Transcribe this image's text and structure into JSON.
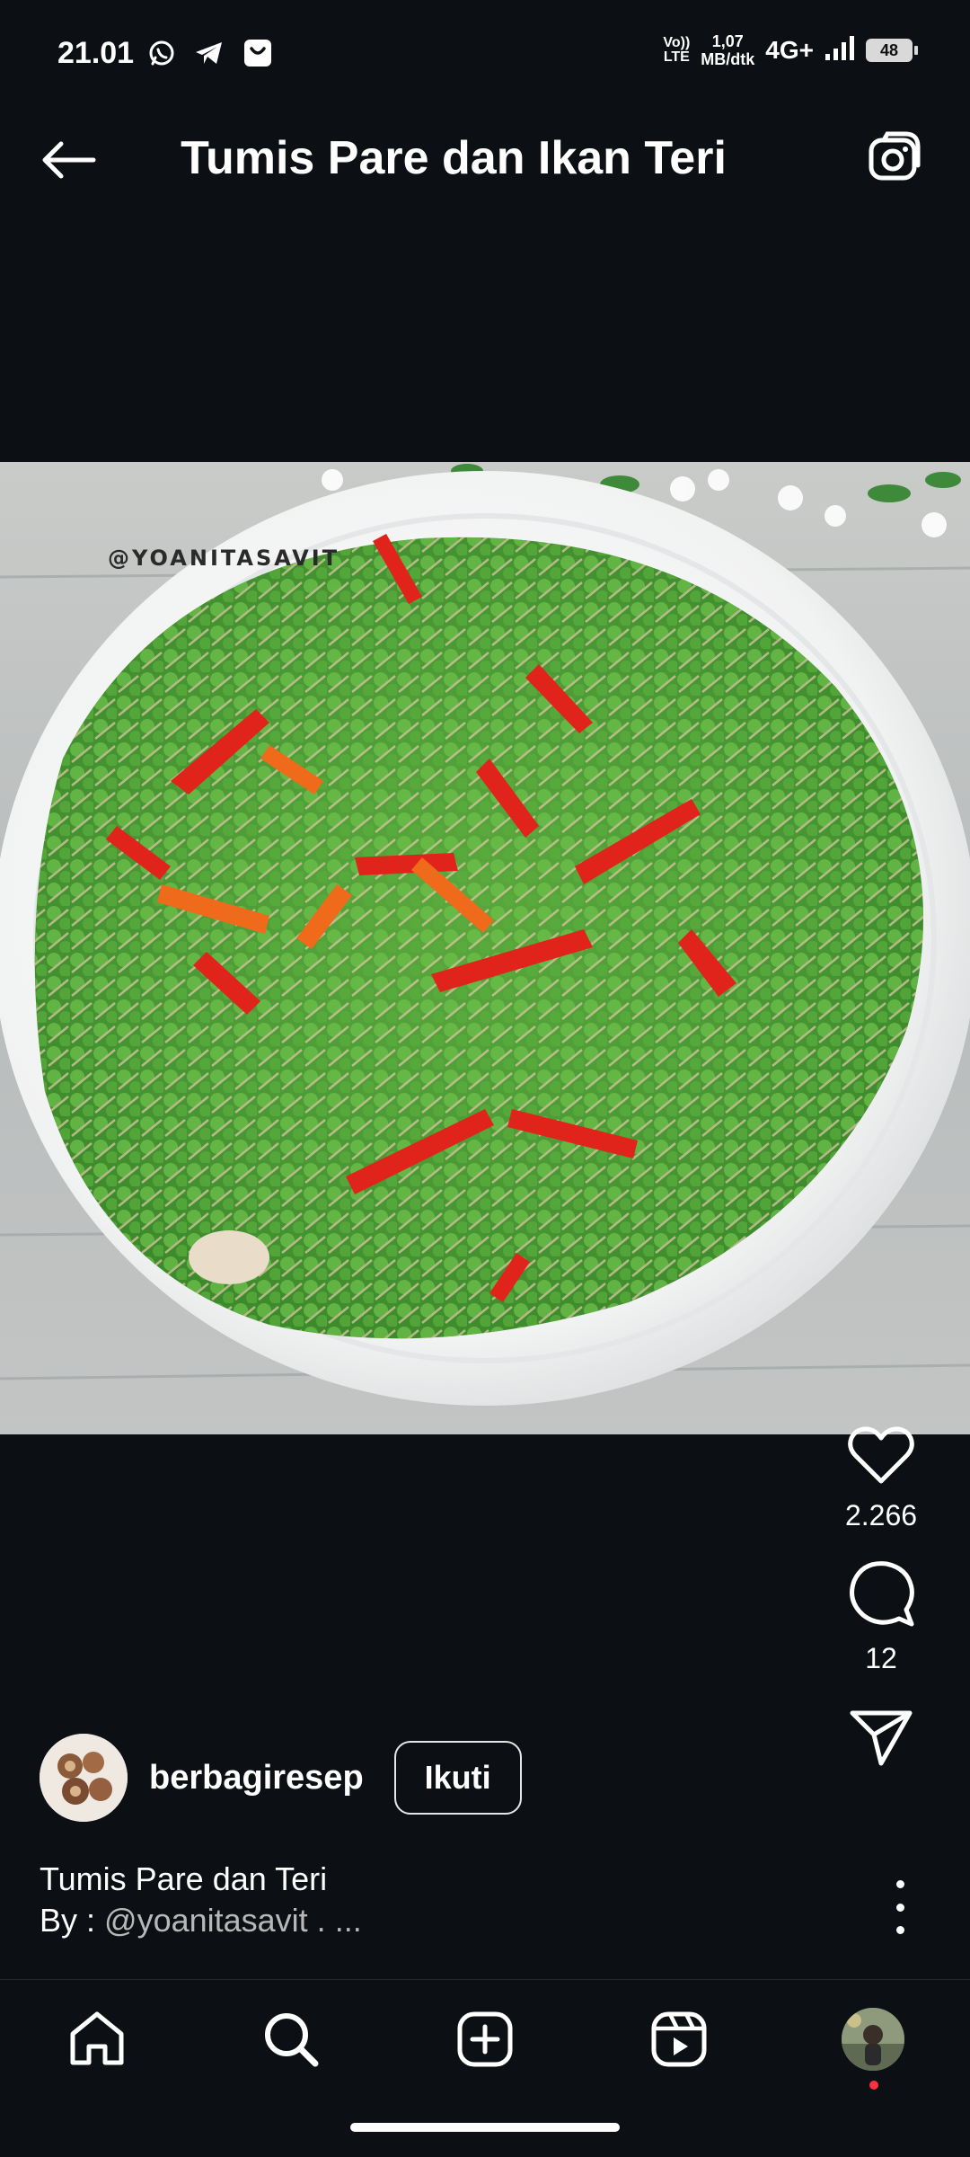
{
  "status_bar": {
    "time": "21.01",
    "volte_line1": "Vo))",
    "volte_line2": "LTE",
    "speed_value": "1,07",
    "speed_unit": "MB/dtk",
    "network": "4G+",
    "battery": "48"
  },
  "header": {
    "title": "Tumis Pare dan Ikan Teri"
  },
  "post": {
    "watermark": "@YOANITASAVIT",
    "likes": "2.266",
    "comments": "12"
  },
  "author": {
    "username": "berbagiresep",
    "follow_label": "Ikuti"
  },
  "caption": {
    "title": "Tumis Pare dan Teri",
    "by_prefix": "By : ",
    "handle": "@yoanitasavit . ..."
  },
  "colors": {
    "background": "#0c1014",
    "text": "#ffffff",
    "notification_dot": "#ff3040"
  },
  "icons": {
    "back": "arrow-left-icon",
    "camera": "camera-icon",
    "like": "heart-icon",
    "comment": "comment-icon",
    "share": "paper-plane-icon",
    "more": "more-vertical-icon",
    "nav": [
      "home-icon",
      "search-icon",
      "create-icon",
      "reels-icon",
      "profile-avatar"
    ]
  }
}
